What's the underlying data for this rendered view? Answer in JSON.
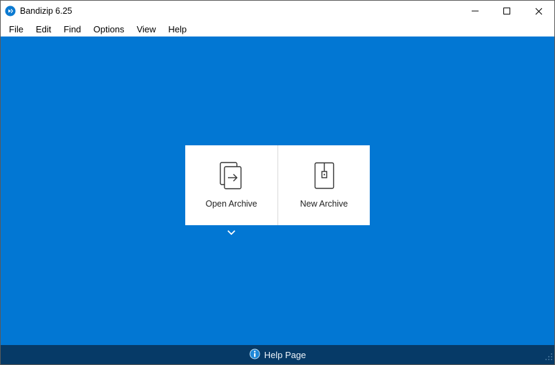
{
  "titlebar": {
    "title": "Bandizip 6.25"
  },
  "menu": {
    "file": "File",
    "edit": "Edit",
    "find": "Find",
    "options": "Options",
    "view": "View",
    "help": "Help"
  },
  "cards": {
    "open_archive": "Open Archive",
    "new_archive": "New Archive"
  },
  "statusbar": {
    "help_page": "Help Page"
  }
}
